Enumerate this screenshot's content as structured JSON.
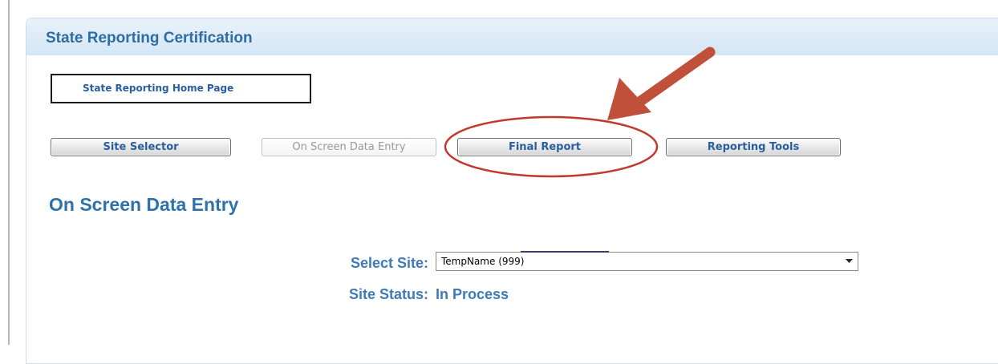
{
  "header": {
    "title": "State Reporting Certification"
  },
  "home_link": {
    "label": "State Reporting Home Page"
  },
  "nav_buttons": {
    "site_selector": "Site Selector",
    "on_screen_data_entry": "On Screen Data Entry",
    "final_report": "Final Report",
    "reporting_tools": "Reporting Tools"
  },
  "main": {
    "heading": "On Screen Data Entry",
    "select_site_label": "Select Site:",
    "select_site_value": "TempName (999)",
    "site_status_label": "Site Status:",
    "site_status_value": "In Process"
  },
  "annotation": {
    "color": "#c0503a",
    "icon": "arrow-pointing-to-final-report"
  },
  "colors": {
    "accent": "#2e6da4",
    "label": "#3d7ab7",
    "header_bg": "#dbe9f6"
  }
}
